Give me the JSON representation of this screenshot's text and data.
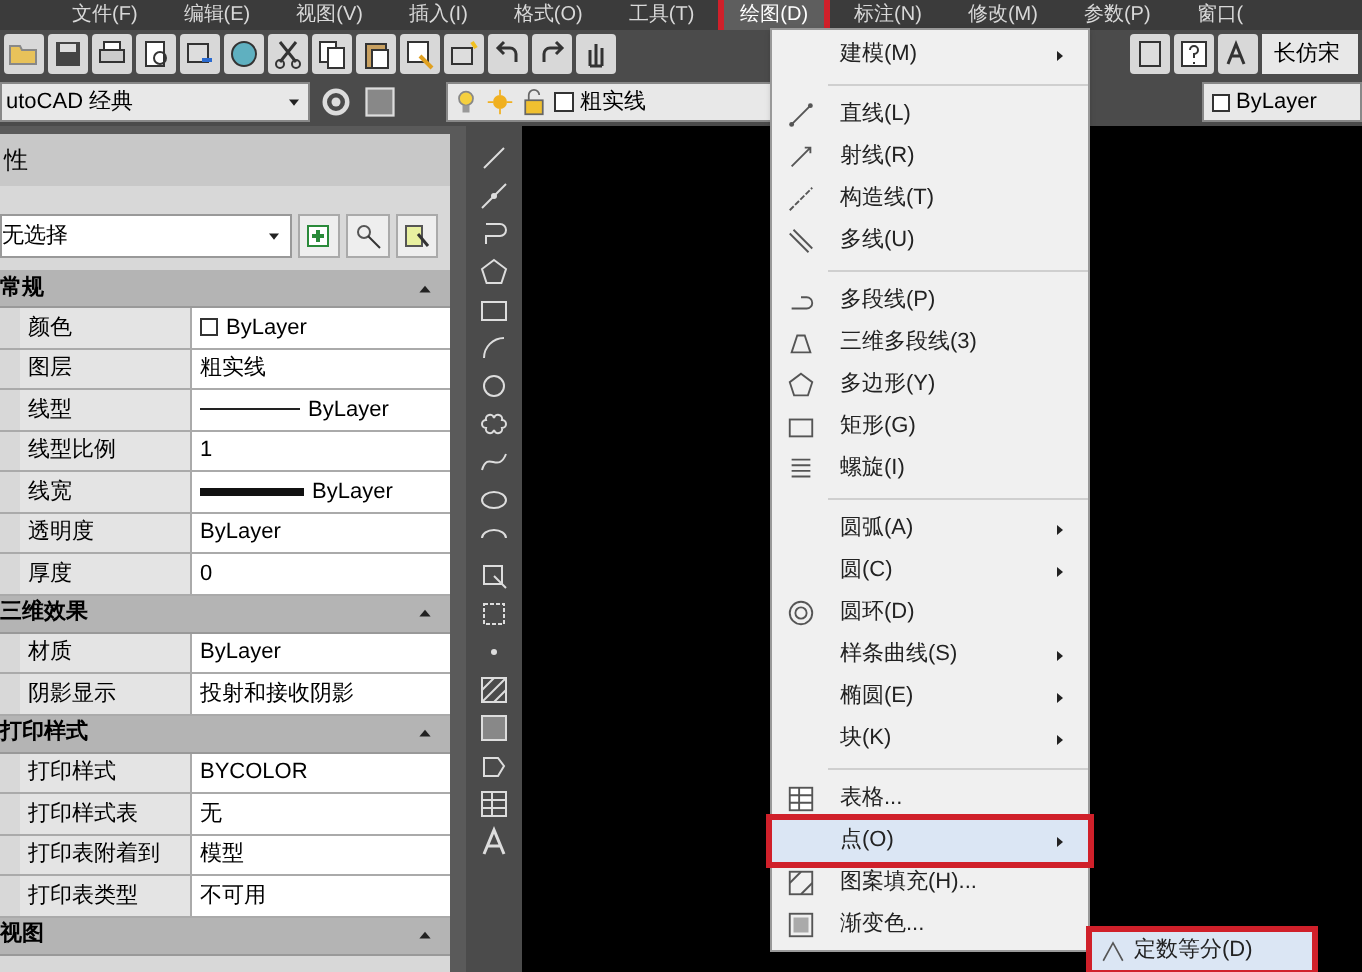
{
  "menu_bar": [
    {
      "label": "文件(F)",
      "selected": false,
      "highlighted": false
    },
    {
      "label": "编辑(E)",
      "selected": false,
      "highlighted": false
    },
    {
      "label": "视图(V)",
      "selected": false,
      "highlighted": false
    },
    {
      "label": "插入(I)",
      "selected": false,
      "highlighted": false
    },
    {
      "label": "格式(O)",
      "selected": false,
      "highlighted": false
    },
    {
      "label": "工具(T)",
      "selected": false,
      "highlighted": false
    },
    {
      "label": "绘图(D)",
      "selected": true,
      "highlighted": true
    },
    {
      "label": "标注(N)",
      "selected": false,
      "highlighted": false
    },
    {
      "label": "修改(M)",
      "selected": false,
      "highlighted": false
    },
    {
      "label": "参数(P)",
      "selected": false,
      "highlighted": false
    },
    {
      "label": "窗口(",
      "selected": false,
      "highlighted": false
    }
  ],
  "toolbar": {
    "workspace": "utoCAD 经典",
    "layer": "粗实线",
    "color_control": "ByLayer",
    "text_style": "长仿宋"
  },
  "properties": {
    "title": "性",
    "selection": "无选择",
    "sections": [
      {
        "title": "常规",
        "expanded": true,
        "rows": [
          {
            "label": "颜色",
            "value": "ByLayer",
            "kind": "color"
          },
          {
            "label": "图层",
            "value": "粗实线",
            "kind": "text"
          },
          {
            "label": "线型",
            "value": "ByLayer",
            "kind": "linetype"
          },
          {
            "label": "线型比例",
            "value": "1",
            "kind": "text"
          },
          {
            "label": "线宽",
            "value": "ByLayer",
            "kind": "lineweight"
          },
          {
            "label": "透明度",
            "value": "ByLayer",
            "kind": "text"
          },
          {
            "label": "厚度",
            "value": "0",
            "kind": "text"
          }
        ]
      },
      {
        "title": "三维效果",
        "expanded": true,
        "rows": [
          {
            "label": "材质",
            "value": "ByLayer",
            "kind": "text"
          },
          {
            "label": "阴影显示",
            "value": "投射和接收阴影",
            "kind": "text"
          }
        ]
      },
      {
        "title": "打印样式",
        "expanded": true,
        "rows": [
          {
            "label": "打印样式",
            "value": "BYCOLOR",
            "kind": "text"
          },
          {
            "label": "打印样式表",
            "value": "无",
            "kind": "text"
          },
          {
            "label": "打印表附着到",
            "value": "模型",
            "kind": "text"
          },
          {
            "label": "打印表类型",
            "value": "不可用",
            "kind": "text"
          }
        ]
      },
      {
        "title": "视图",
        "expanded": true
      }
    ]
  },
  "draw_menu": {
    "groups": [
      [
        {
          "label": "建模(M)",
          "submenu": true,
          "selected": false,
          "highlighted": false
        }
      ],
      [
        {
          "label": "直线(L)",
          "submenu": false,
          "selected": false,
          "highlighted": false
        },
        {
          "label": "射线(R)",
          "submenu": false,
          "selected": false,
          "highlighted": false
        },
        {
          "label": "构造线(T)",
          "submenu": false,
          "selected": false,
          "highlighted": false
        },
        {
          "label": "多线(U)",
          "submenu": false,
          "selected": false,
          "highlighted": false
        }
      ],
      [
        {
          "label": "多段线(P)",
          "submenu": false,
          "selected": false,
          "highlighted": false
        },
        {
          "label": "三维多段线(3)",
          "submenu": false,
          "selected": false,
          "highlighted": false
        },
        {
          "label": "多边形(Y)",
          "submenu": false,
          "selected": false,
          "highlighted": false
        },
        {
          "label": "矩形(G)",
          "submenu": false,
          "selected": false,
          "highlighted": false
        },
        {
          "label": "螺旋(I)",
          "submenu": false,
          "selected": false,
          "highlighted": false
        }
      ],
      [
        {
          "label": "圆弧(A)",
          "submenu": true,
          "selected": false,
          "highlighted": false
        },
        {
          "label": "圆(C)",
          "submenu": true,
          "selected": false,
          "highlighted": false
        },
        {
          "label": "圆环(D)",
          "submenu": false,
          "selected": false,
          "highlighted": false
        },
        {
          "label": "样条曲线(S)",
          "submenu": true,
          "selected": false,
          "highlighted": false
        },
        {
          "label": "椭圆(E)",
          "submenu": true,
          "selected": false,
          "highlighted": false
        },
        {
          "label": "块(K)",
          "submenu": true,
          "selected": false,
          "highlighted": false
        }
      ],
      [
        {
          "label": "表格...",
          "submenu": false,
          "selected": false,
          "highlighted": false
        },
        {
          "label": "点(O)",
          "submenu": true,
          "selected": true,
          "highlighted": true
        },
        {
          "label": "图案填充(H)...",
          "submenu": false,
          "selected": false,
          "highlighted": false
        },
        {
          "label": "渐变色...",
          "submenu": false,
          "selected": false,
          "highlighted": false
        }
      ]
    ]
  },
  "point_submenu": [
    {
      "label": "定数等分(D)",
      "selected": true,
      "highlighted": true
    }
  ]
}
